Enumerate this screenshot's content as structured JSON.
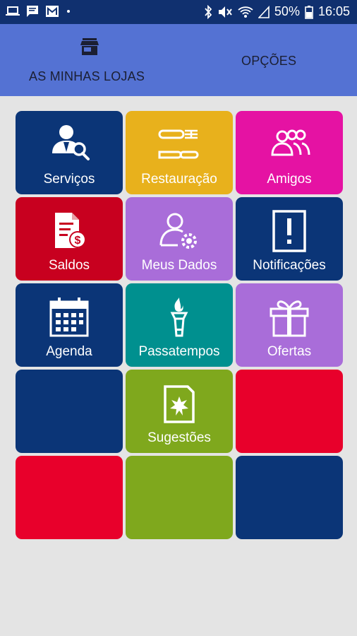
{
  "status_bar": {
    "left_icons": [
      "laptop-icon",
      "chat-icon",
      "mail-icon",
      "dot-icon"
    ],
    "right_icons": [
      "bluetooth-icon",
      "mute-icon",
      "wifi-icon",
      "signal-icon",
      "battery-icon"
    ],
    "battery": "50%",
    "time": "16:05"
  },
  "tabs": {
    "stores_label": "AS MINHAS LOJAS",
    "options_label": "OPÇÕES",
    "stores_icon": "store-icon"
  },
  "grid": {
    "tiles": [
      {
        "label": "Serviços",
        "icon": "person-search-icon",
        "color": "#0b3577"
      },
      {
        "label": "Restauração",
        "icon": "cutlery-icon",
        "color": "#e8b11c"
      },
      {
        "label": "Amigos",
        "icon": "group-icon",
        "color": "#e512a3"
      },
      {
        "label": "Saldos",
        "icon": "document-money-icon",
        "color": "#c8001f"
      },
      {
        "label": "Meus Dados",
        "icon": "user-settings-icon",
        "color": "#a96dd9"
      },
      {
        "label": "Notificações",
        "icon": "exclamation-icon",
        "color": "#0b3577"
      },
      {
        "label": "Agenda",
        "icon": "calendar-icon",
        "color": "#0b3577"
      },
      {
        "label": "Passatempos",
        "icon": "torch-icon",
        "color": "#00908f"
      },
      {
        "label": "Ofertas",
        "icon": "gift-icon",
        "color": "#a96dd9"
      },
      {
        "label": "",
        "icon": "",
        "color": "#0b3577"
      },
      {
        "label": "Sugestões",
        "icon": "suggestion-card-icon",
        "color": "#7fa81d"
      },
      {
        "label": "",
        "icon": "",
        "color": "#e8002b"
      },
      {
        "label": "",
        "icon": "",
        "color": "#e8002b"
      },
      {
        "label": "",
        "icon": "",
        "color": "#7fa81d"
      },
      {
        "label": "",
        "icon": "",
        "color": "#0b3577"
      }
    ]
  }
}
